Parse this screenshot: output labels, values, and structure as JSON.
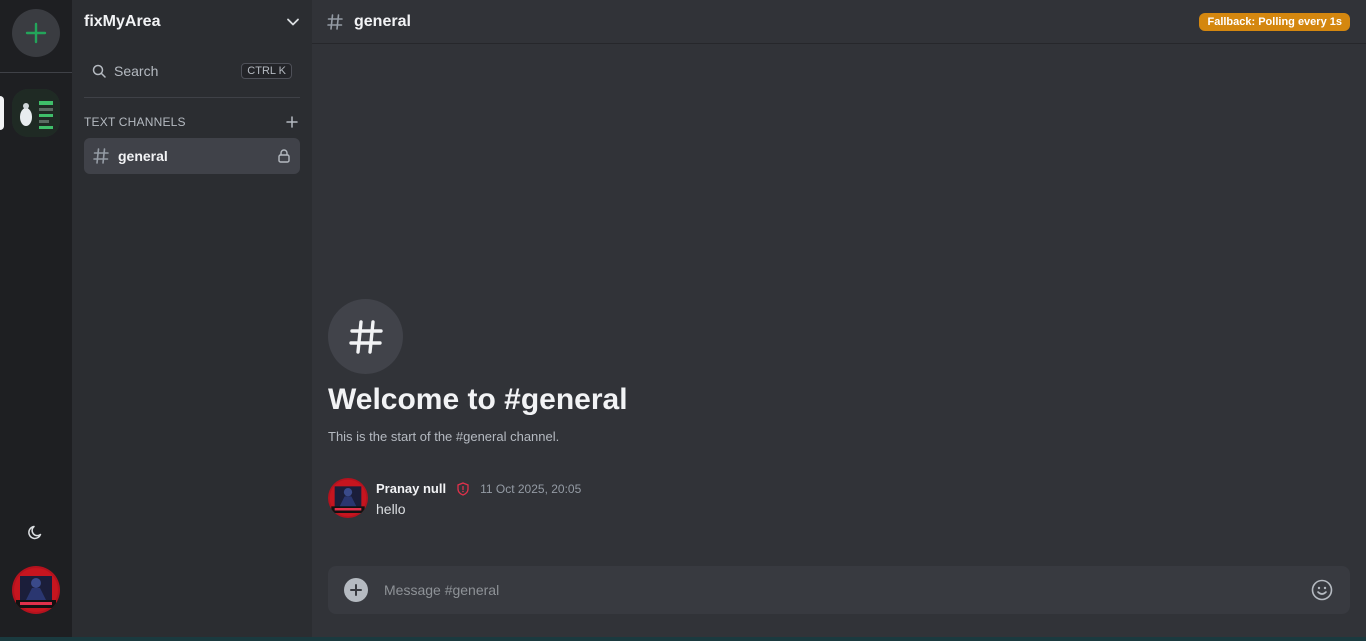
{
  "server": {
    "name": "fixMyArea"
  },
  "search": {
    "label": "Search",
    "shortcut": "CTRL K"
  },
  "categories": [
    {
      "title": "TEXT CHANNELS",
      "channels": [
        {
          "name": "general"
        }
      ]
    }
  ],
  "header": {
    "channel": "general",
    "status_badge": "Fallback: Polling every 1s"
  },
  "welcome": {
    "title": "Welcome to #general",
    "subtitle": "This is the start of the #general channel."
  },
  "messages": [
    {
      "author": "Pranay null",
      "timestamp": "11 Oct 2025, 20:05",
      "text": "hello"
    }
  ],
  "composer": {
    "placeholder": "Message #general"
  },
  "colors": {
    "accent_green": "#23a55a",
    "badge": "#d4870f",
    "moderator_red": "#e0314b"
  }
}
